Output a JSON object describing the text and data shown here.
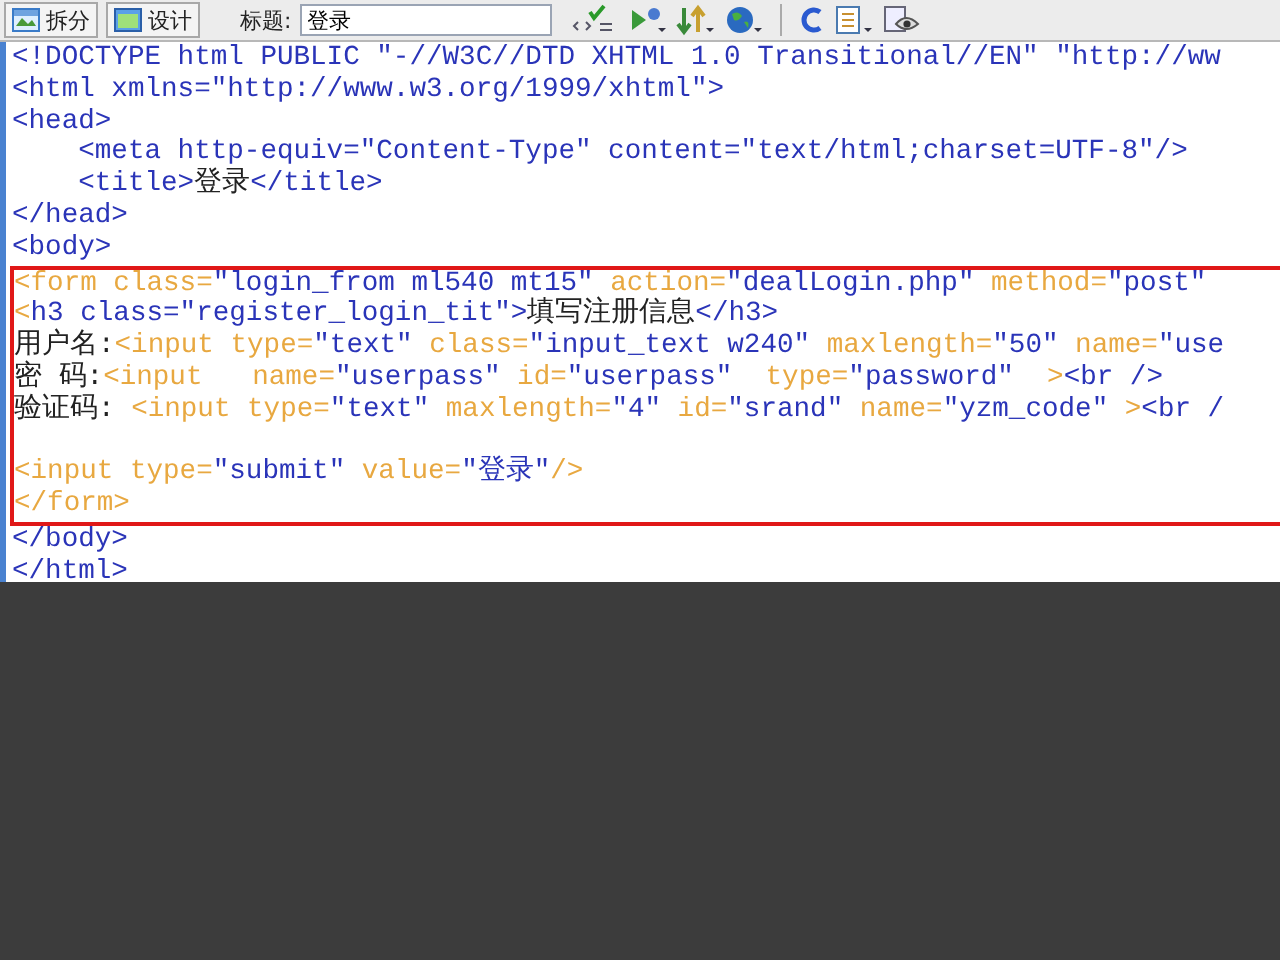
{
  "toolbar": {
    "view_buttons": [
      {
        "label": "拆分"
      },
      {
        "label": "设计"
      }
    ],
    "title_label": "标题:",
    "title_value": "登录"
  },
  "code": {
    "lines_before": [
      {
        "segments": [
          {
            "kind": "tag",
            "text": "<!DOCTYPE html PUBLIC \"-//W3C//DTD XHTML 1.0 Transitional//EN\" \"http://ww"
          }
        ]
      },
      {
        "segments": [
          {
            "kind": "tag",
            "text": "<html xmlns=\"http://www.w3.org/1999/xhtml\">"
          }
        ]
      },
      {
        "segments": [
          {
            "kind": "tag",
            "text": "<head>"
          }
        ]
      },
      {
        "segments": [
          {
            "kind": "tag",
            "text": "    <meta http-equiv=\"Content-Type\" content=\"text/html;charset=UTF-8\"/>"
          }
        ]
      },
      {
        "segments": [
          {
            "kind": "tag",
            "text": "    <title>"
          },
          {
            "kind": "text",
            "text": "登录"
          },
          {
            "kind": "tag",
            "text": "</title>"
          }
        ]
      },
      {
        "segments": [
          {
            "kind": "tag",
            "text": "</head>"
          }
        ]
      },
      {
        "segments": [
          {
            "kind": "tag",
            "text": "<body>"
          }
        ]
      }
    ],
    "selection": [
      {
        "segments": [
          {
            "kind": "attr",
            "text": "<form class="
          },
          {
            "kind": "tag",
            "text": "\"login_from ml540 mt15\""
          },
          {
            "kind": "attr",
            "text": " action="
          },
          {
            "kind": "tag",
            "text": "\"dealLogin.php\""
          },
          {
            "kind": "attr",
            "text": " method="
          },
          {
            "kind": "tag",
            "text": "\"post\""
          }
        ]
      },
      {
        "segments": [
          {
            "kind": "attr",
            "text": "<"
          },
          {
            "kind": "tag",
            "text": "h3 class=\"register_login_tit\">"
          },
          {
            "kind": "text",
            "text": "填写注册信息"
          },
          {
            "kind": "tag",
            "text": "</h3>"
          }
        ]
      },
      {
        "segments": [
          {
            "kind": "text",
            "text": "用户名:"
          },
          {
            "kind": "attr",
            "text": "<input type="
          },
          {
            "kind": "tag",
            "text": "\"text\""
          },
          {
            "kind": "attr",
            "text": " class="
          },
          {
            "kind": "tag",
            "text": "\"input_text w240\""
          },
          {
            "kind": "attr",
            "text": " maxlength="
          },
          {
            "kind": "tag",
            "text": "\"50\""
          },
          {
            "kind": "attr",
            "text": " name="
          },
          {
            "kind": "tag",
            "text": "\"use"
          }
        ]
      },
      {
        "segments": [
          {
            "kind": "text",
            "text": "密 码:"
          },
          {
            "kind": "attr",
            "text": "<input   name="
          },
          {
            "kind": "tag",
            "text": "\"userpass\""
          },
          {
            "kind": "attr",
            "text": " id="
          },
          {
            "kind": "tag",
            "text": "\"userpass\""
          },
          {
            "kind": "attr",
            "text": "  type="
          },
          {
            "kind": "tag",
            "text": "\"password\""
          },
          {
            "kind": "attr",
            "text": "  >"
          },
          {
            "kind": "tag",
            "text": "<br />"
          }
        ]
      },
      {
        "segments": [
          {
            "kind": "text",
            "text": "验证码: "
          },
          {
            "kind": "attr",
            "text": "<input type="
          },
          {
            "kind": "tag",
            "text": "\"text\""
          },
          {
            "kind": "attr",
            "text": " maxlength="
          },
          {
            "kind": "tag",
            "text": "\"4\""
          },
          {
            "kind": "attr",
            "text": " id="
          },
          {
            "kind": "tag",
            "text": "\"srand\""
          },
          {
            "kind": "attr",
            "text": " name="
          },
          {
            "kind": "tag",
            "text": "\"yzm_code\""
          },
          {
            "kind": "attr",
            "text": " >"
          },
          {
            "kind": "tag",
            "text": "<br /"
          }
        ]
      },
      {
        "kind": "blank"
      },
      {
        "segments": [
          {
            "kind": "attr",
            "text": "<input type="
          },
          {
            "kind": "tag",
            "text": "\"submit\""
          },
          {
            "kind": "attr",
            "text": " value="
          },
          {
            "kind": "tag",
            "text": "\"登录\""
          },
          {
            "kind": "attr",
            "text": "/>"
          }
        ]
      },
      {
        "segments": [
          {
            "kind": "attr",
            "text": "</form>"
          }
        ]
      }
    ],
    "lines_after": [
      {
        "segments": [
          {
            "kind": "tag",
            "text": "</body>"
          }
        ]
      },
      {
        "segments": [
          {
            "kind": "tag",
            "text": "</html>"
          }
        ]
      }
    ]
  }
}
